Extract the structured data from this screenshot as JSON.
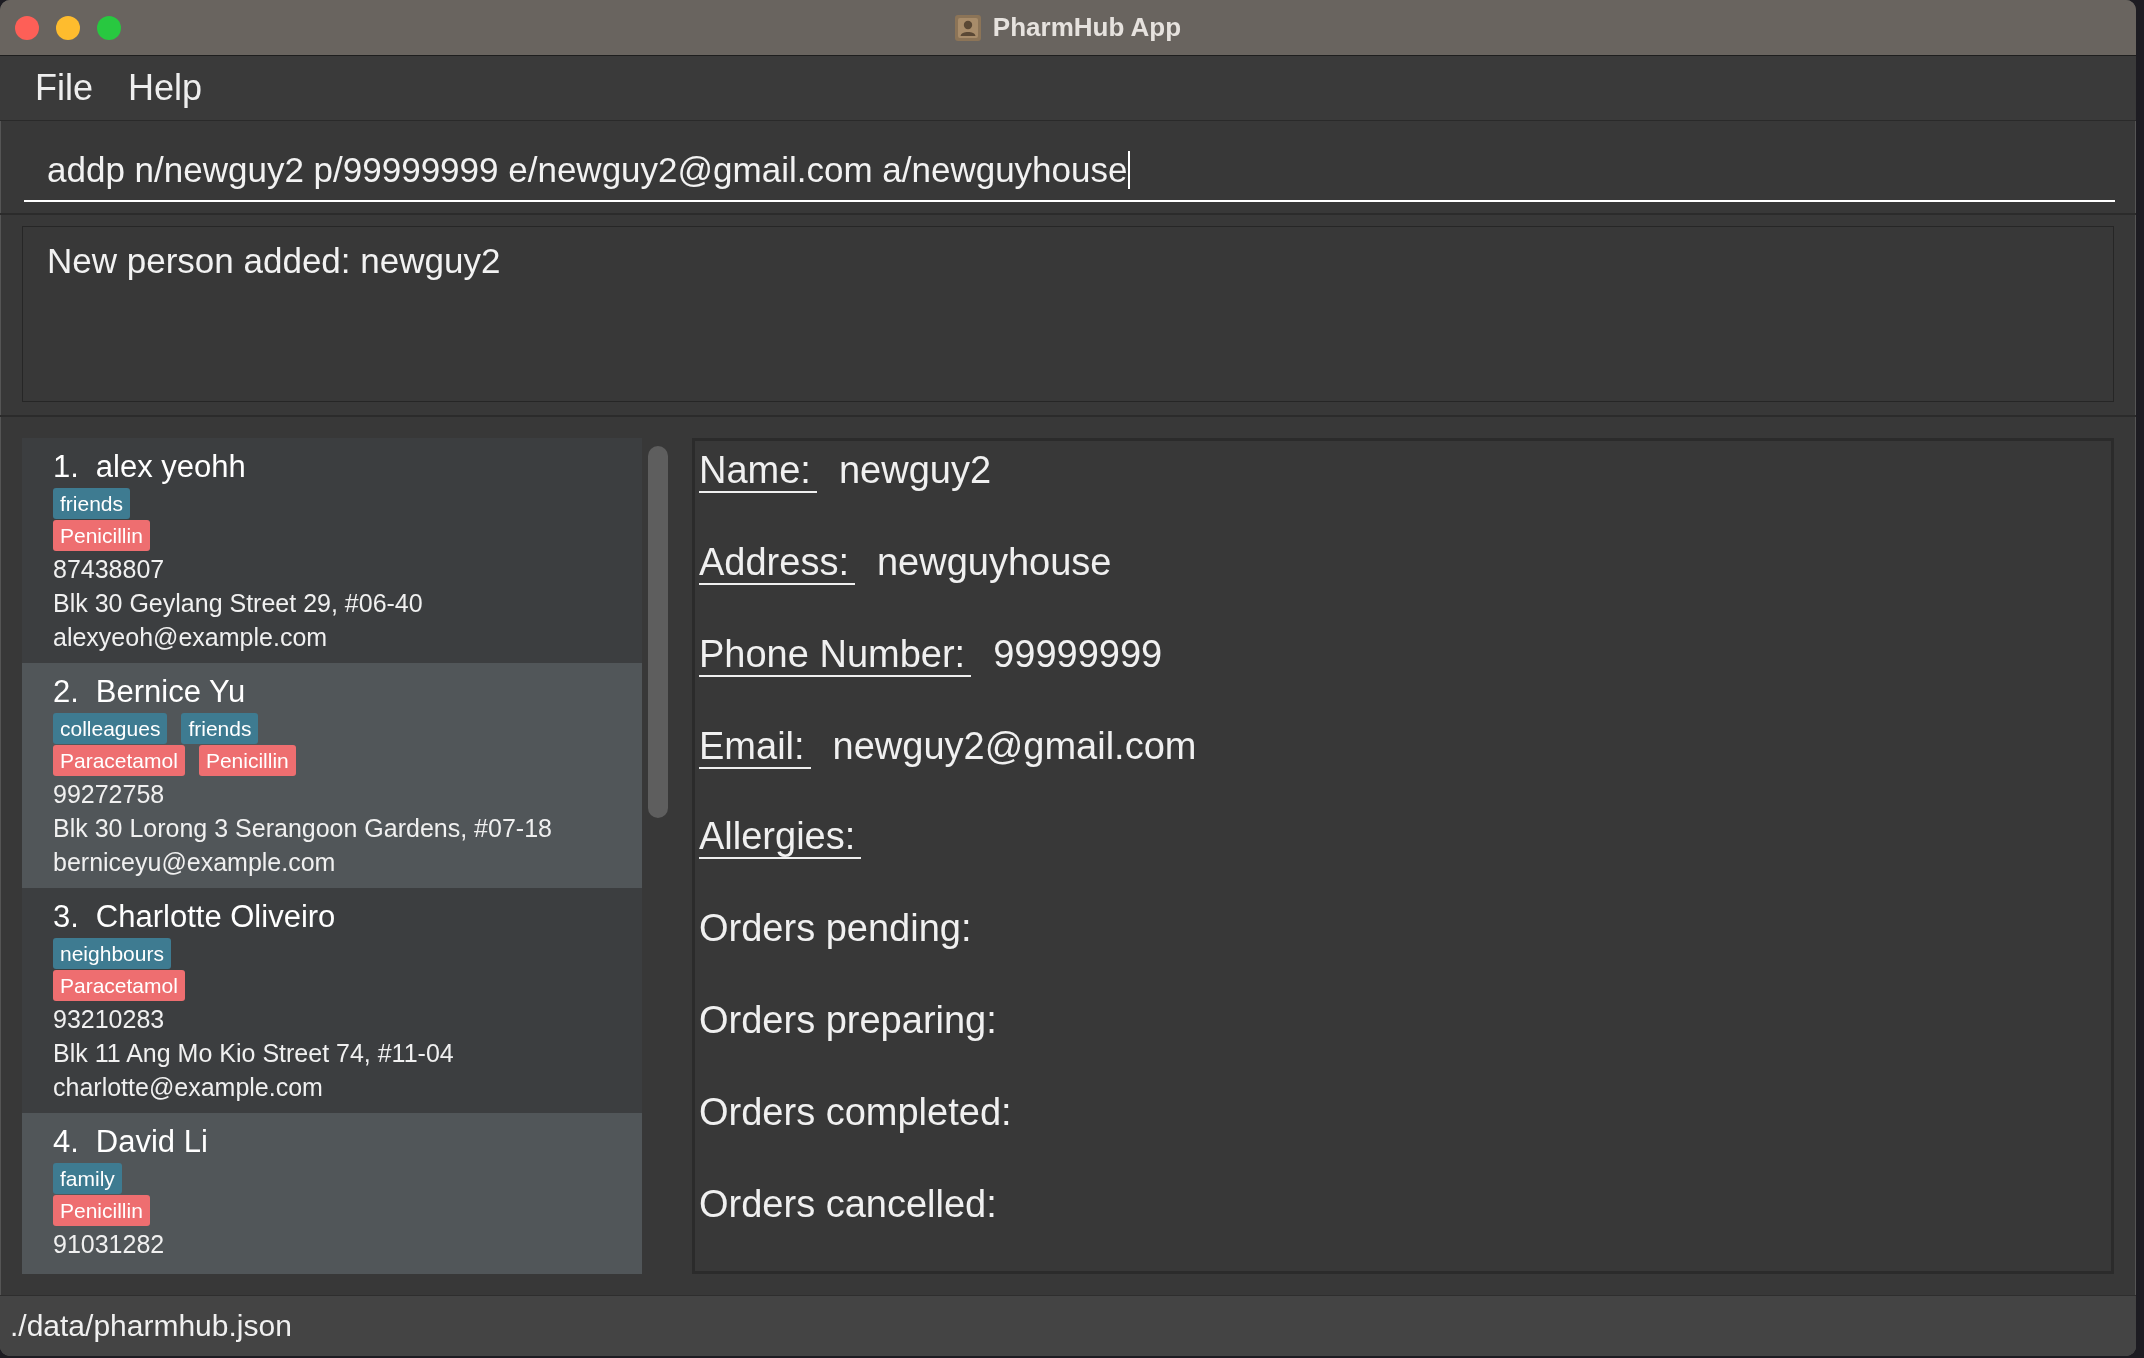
{
  "window": {
    "title": "PharmHub App"
  },
  "menu_bar": [
    {
      "label": "File"
    },
    {
      "label": "Help"
    }
  ],
  "command_box": {
    "value": "addp n/newguy2 p/99999999 e/newguy2@gmail.com a/newguyhouse",
    "focused": true
  },
  "result_display": {
    "text": "New person added: newguy2"
  },
  "person_list": [
    {
      "index": "1.",
      "name": "alex yeohh",
      "tags": [
        "friends"
      ],
      "allergies": [
        "Penicillin"
      ],
      "phone": "87438807",
      "address": "Blk 30 Geylang Street 29, #06-40",
      "email": "alexyeoh@example.com"
    },
    {
      "index": "2.",
      "name": "Bernice Yu",
      "tags": [
        "colleagues",
        "friends"
      ],
      "allergies": [
        "Paracetamol",
        "Penicillin"
      ],
      "phone": "99272758",
      "address": "Blk 30 Lorong 3 Serangoon Gardens, #07-18",
      "email": "berniceyu@example.com"
    },
    {
      "index": "3.",
      "name": "Charlotte Oliveiro",
      "tags": [
        "neighbours"
      ],
      "allergies": [
        "Paracetamol"
      ],
      "phone": "93210283",
      "address": "Blk 11 Ang Mo Kio Street 74, #11-04",
      "email": "charlotte@example.com"
    },
    {
      "index": "4.",
      "name": "David Li",
      "tags": [
        "family"
      ],
      "allergies": [
        "Penicillin"
      ],
      "phone": "91031282"
    }
  ],
  "person_details": {
    "fields": [
      {
        "label": "Name:",
        "value": "newguy2"
      },
      {
        "label": "Address:",
        "value": "newguyhouse"
      },
      {
        "label": "Phone Number:",
        "value": "99999999"
      },
      {
        "label": "Email:",
        "value": "newguy2@gmail.com"
      },
      {
        "label": "Allergies:"
      }
    ],
    "order_sections": [
      {
        "label": "Orders pending:"
      },
      {
        "label": "Orders preparing:"
      },
      {
        "label": "Orders completed:"
      },
      {
        "label": "Orders cancelled:"
      }
    ]
  },
  "status_bar": {
    "path": "./data/pharmhub.json"
  }
}
